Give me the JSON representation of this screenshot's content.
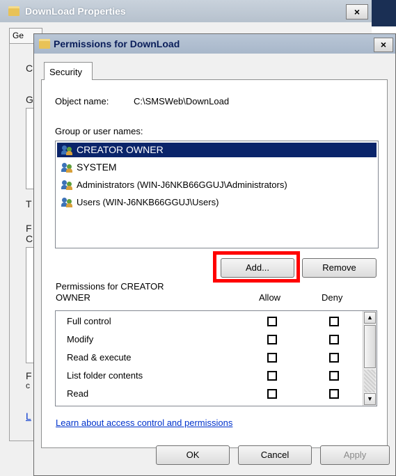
{
  "background_window": {
    "title": "DownLoad Properties",
    "close_glyph": "×",
    "tab_label": "Ge",
    "letters": [
      "C",
      "G",
      "T",
      "F",
      "C",
      "F",
      "c",
      "L"
    ]
  },
  "dialog": {
    "title": "Permissions for DownLoad",
    "close_glyph": "×",
    "tab_label": "Security",
    "object_name_label": "Object name:",
    "object_name_value": "C:\\SMSWeb\\DownLoad",
    "group_label": "Group or user names:",
    "users": [
      {
        "name": "CREATOR OWNER",
        "selected": true
      },
      {
        "name": "SYSTEM",
        "selected": false
      },
      {
        "name": "Administrators (WIN-J6NKB66GGUJ\\Administrators)",
        "selected": false
      },
      {
        "name": "Users (WIN-J6NKB66GGUJ\\Users)",
        "selected": false
      }
    ],
    "add_button": "Add...",
    "remove_button": "Remove",
    "permissions_for_line1": "Permissions for CREATOR",
    "permissions_for_line2": "OWNER",
    "allow_header": "Allow",
    "deny_header": "Deny",
    "permissions": [
      {
        "name": "Full control",
        "allow": false,
        "deny": false
      },
      {
        "name": "Modify",
        "allow": false,
        "deny": false
      },
      {
        "name": "Read & execute",
        "allow": false,
        "deny": false
      },
      {
        "name": "List folder contents",
        "allow": false,
        "deny": false
      },
      {
        "name": "Read",
        "allow": false,
        "deny": false
      }
    ],
    "learn_link": "Learn about access control and permissions",
    "ok_button": "OK",
    "cancel_button": "Cancel",
    "apply_button": "Apply"
  },
  "colors": {
    "selection": "#0a246a",
    "highlight_box": "#ff0000",
    "link": "#0033cc"
  }
}
